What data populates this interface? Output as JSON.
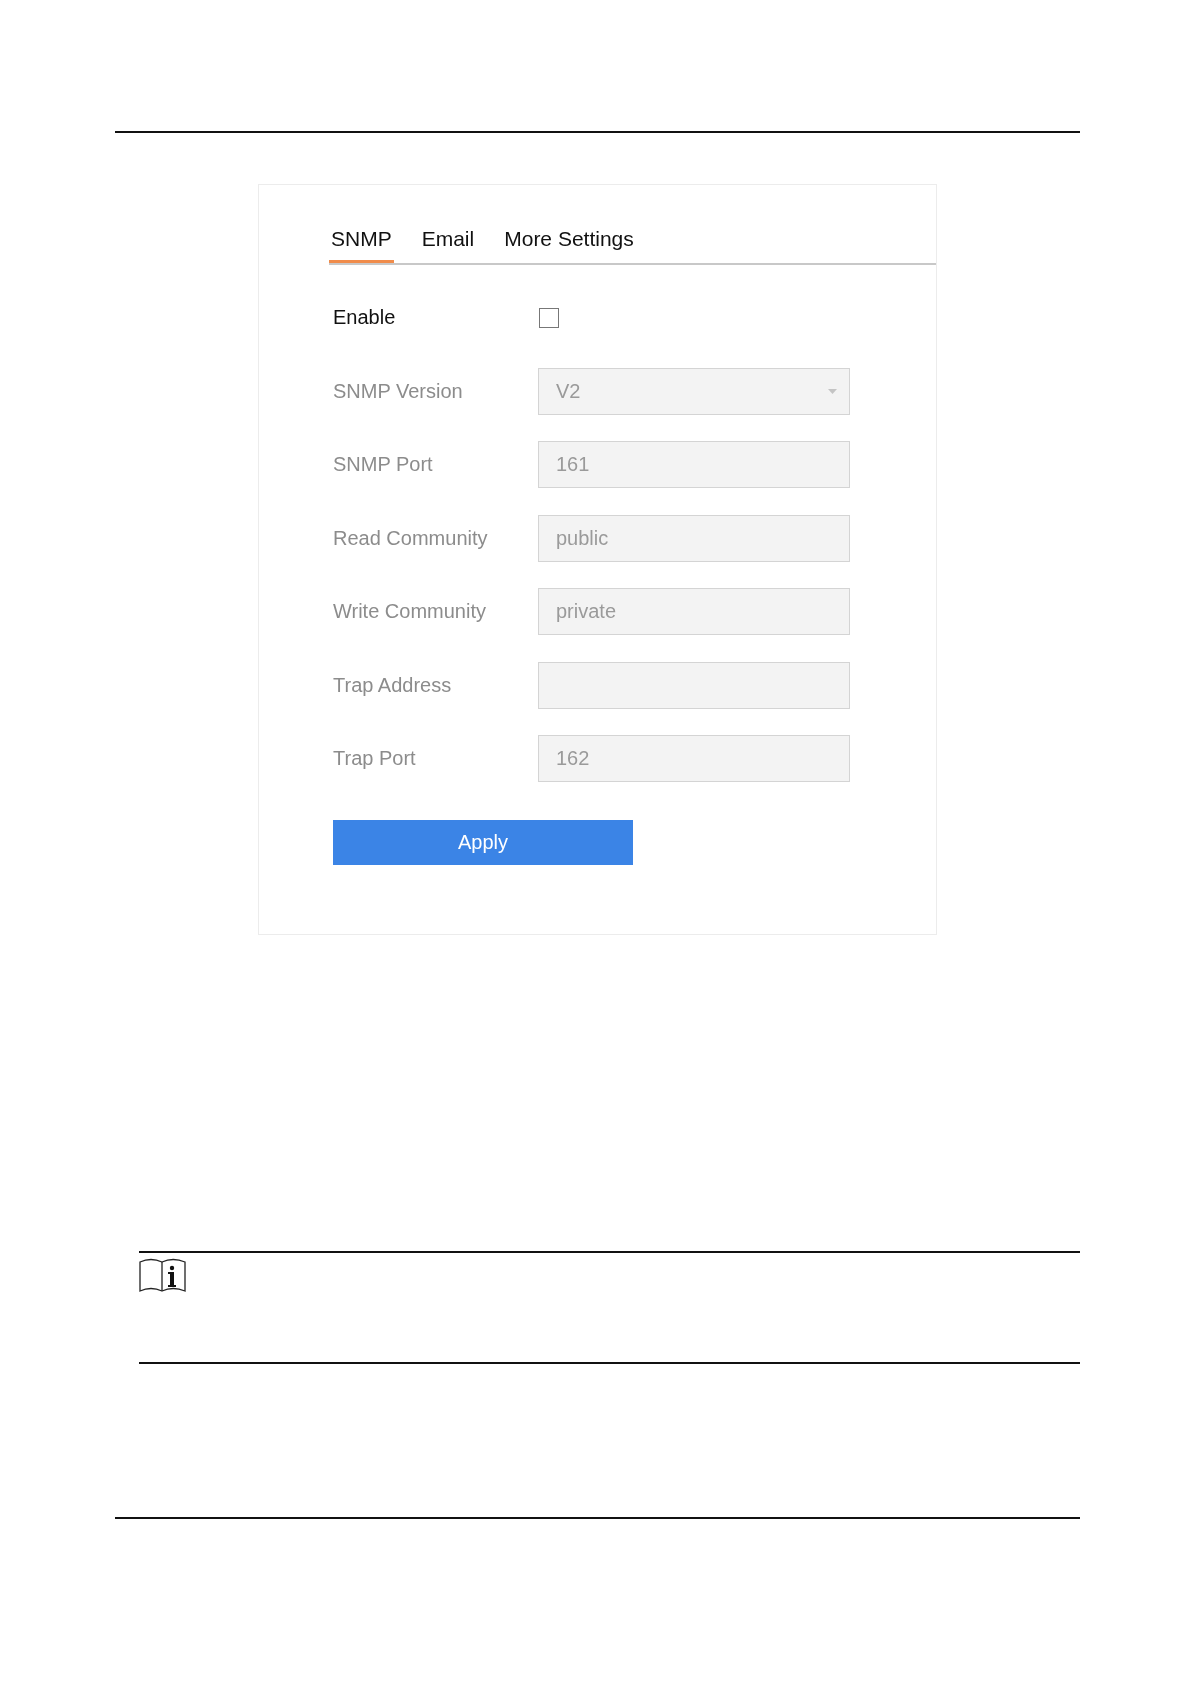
{
  "tabs": [
    {
      "label": "SNMP",
      "selected": true
    },
    {
      "label": "Email",
      "selected": false
    },
    {
      "label": "More Settings",
      "selected": false
    }
  ],
  "fields": [
    {
      "kind": "checkbox",
      "label": "Enable",
      "checked": false,
      "disabled": false
    },
    {
      "kind": "dropdown",
      "label": "SNMP Version",
      "value": "V2",
      "disabled": true
    },
    {
      "kind": "text",
      "label": "SNMP Port",
      "value": "161",
      "disabled": true
    },
    {
      "kind": "text",
      "label": "Read Community",
      "value": "public",
      "disabled": true
    },
    {
      "kind": "text",
      "label": "Write Community",
      "value": "private",
      "disabled": true
    },
    {
      "kind": "text",
      "label": "Trap Address",
      "disabled": true
    },
    {
      "kind": "text",
      "label": "Trap Port",
      "value": "162",
      "disabled": true
    }
  ],
  "apply_button": {
    "label": "Apply"
  }
}
